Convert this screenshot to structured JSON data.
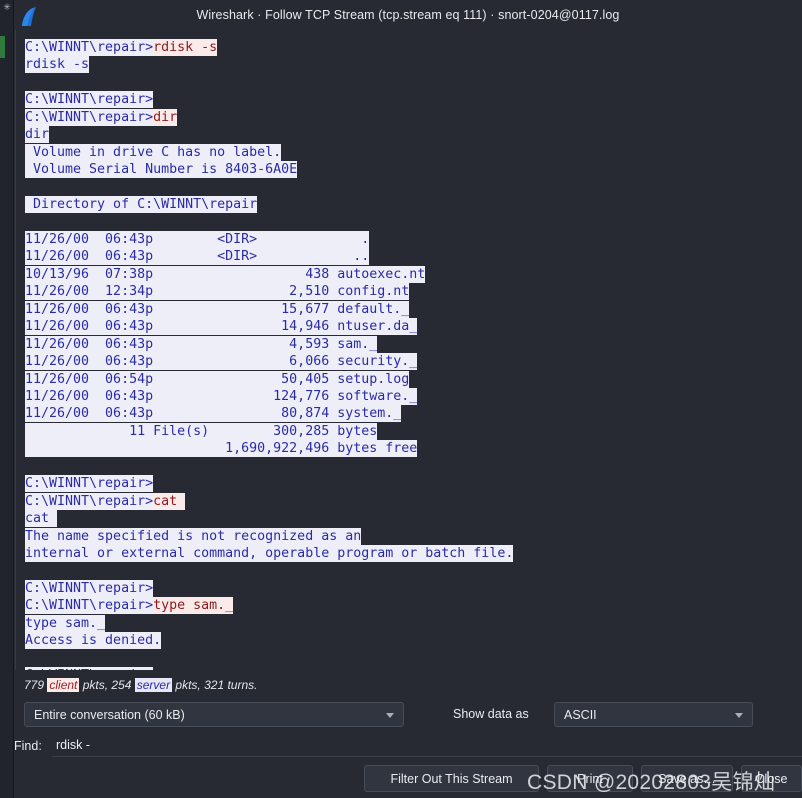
{
  "window": {
    "title": "Wireshark · Follow TCP Stream (tcp.stream eq 111) · snort-0204@0117.log",
    "logo_icon": "wireshark-shark-fin-icon"
  },
  "colors": {
    "dialog_bg": "#272a33",
    "server_text": "#2b2ba6",
    "server_bg": "#eeeef8",
    "client_text": "#8e1b1b",
    "client_bg": "#fbeaea",
    "control_bg": "#31353f",
    "control_border": "#474c59",
    "label_text": "#e9ebef"
  },
  "stream": {
    "segments": [
      {
        "dir": "server",
        "text": "C:\\WINNT\\repair>"
      },
      {
        "dir": "client",
        "text": "rdisk -s"
      },
      {
        "dir": "server",
        "text": "\nrdisk -s"
      },
      {
        "dir": "blank",
        "text": ""
      },
      {
        "dir": "server",
        "text": "C:\\WINNT\\repair>"
      },
      {
        "dir": "newline",
        "text": ""
      },
      {
        "dir": "server",
        "text": "C:\\WINNT\\repair>"
      },
      {
        "dir": "client",
        "text": "dir"
      },
      {
        "dir": "server",
        "text": "\ndir"
      },
      {
        "dir": "server",
        "text": "\n Volume in drive C has no label."
      },
      {
        "dir": "server",
        "text": "\n Volume Serial Number is 8403-6A0E"
      },
      {
        "dir": "blank",
        "text": ""
      },
      {
        "dir": "server",
        "text": " Directory of C:\\WINNT\\repair"
      },
      {
        "dir": "blank",
        "text": ""
      },
      {
        "dir": "server",
        "text": "11/26/00  06:43p        <DIR>             ."
      },
      {
        "dir": "server",
        "text": "\n11/26/00  06:43p        <DIR>            .."
      },
      {
        "dir": "server",
        "text": "\n10/13/96  07:38p                   438 autoexec.nt"
      },
      {
        "dir": "server",
        "text": "\n11/26/00  12:34p                 2,510 config.nt"
      },
      {
        "dir": "server",
        "text": "\n11/26/00  06:43p                15,677 default._"
      },
      {
        "dir": "server",
        "text": "\n11/26/00  06:43p                14,946 ntuser.da_"
      },
      {
        "dir": "server",
        "text": "\n11/26/00  06:43p                 4,593 sam._"
      },
      {
        "dir": "server",
        "text": "\n11/26/00  06:43p                 6,066 security._"
      },
      {
        "dir": "server",
        "text": "\n11/26/00  06:54p                50,405 setup.log"
      },
      {
        "dir": "server",
        "text": "\n11/26/00  06:43p               124,776 software._"
      },
      {
        "dir": "server",
        "text": "\n11/26/00  06:43p                80,874 system._"
      },
      {
        "dir": "server",
        "text": "\n             11 File(s)        300,285 bytes"
      },
      {
        "dir": "server",
        "text": "\n                         1,690,922,496 bytes free"
      },
      {
        "dir": "blank",
        "text": ""
      },
      {
        "dir": "server",
        "text": "C:\\WINNT\\repair>"
      },
      {
        "dir": "newline",
        "text": ""
      },
      {
        "dir": "server",
        "text": "C:\\WINNT\\repair>"
      },
      {
        "dir": "client",
        "text": "cat "
      },
      {
        "dir": "server",
        "text": "\ncat "
      },
      {
        "dir": "server",
        "text": "\nThe name specified is not recognized as an"
      },
      {
        "dir": "server",
        "text": "\ninternal or external command, operable program or batch file."
      },
      {
        "dir": "blank",
        "text": ""
      },
      {
        "dir": "server",
        "text": "C:\\WINNT\\repair>"
      },
      {
        "dir": "newline",
        "text": ""
      },
      {
        "dir": "server",
        "text": "C:\\WINNT\\repair>"
      },
      {
        "dir": "client",
        "text": "type sam._"
      },
      {
        "dir": "server",
        "text": "\ntype sam._"
      },
      {
        "dir": "server",
        "text": "\nAccess is denied."
      },
      {
        "dir": "blank",
        "text": ""
      },
      {
        "dir": "server",
        "text": "C:\\WINNT\\repair>"
      }
    ]
  },
  "status": {
    "prefix": "779 ",
    "client_word": "client",
    "middle": " pkts, 254 ",
    "server_word": "server",
    "suffix": " pkts, 321 turns."
  },
  "controls": {
    "conversation_value": "Entire conversation (60 kB)",
    "show_data_as_label": "Show data as",
    "show_data_as_value": "ASCII",
    "find_label": "Find:",
    "find_value": "rdisk -",
    "find_placeholder": "Find"
  },
  "buttons": {
    "filter_out": "Filter Out This Stream",
    "print": "Print",
    "save_as": "Save as…",
    "close": "Close"
  },
  "overlay": {
    "watermark": "CSDN @20202803吴锦灿"
  }
}
